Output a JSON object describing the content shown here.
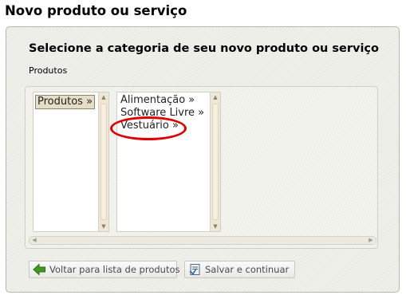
{
  "page": {
    "heading": "Novo produto ou serviço"
  },
  "form": {
    "title": "Selecione a categoria de seu novo produto ou serviço",
    "breadcrumb": "Produtos"
  },
  "category_lists": [
    {
      "options": [
        {
          "label": "Produtos »",
          "selected": true
        }
      ]
    },
    {
      "options": [
        {
          "label": "Alimentação »",
          "selected": false
        },
        {
          "label": "Software Livre »",
          "selected": false
        },
        {
          "label": "Vestuário »",
          "selected": false
        }
      ]
    }
  ],
  "annotation": {
    "highlight_color": "#e00000",
    "highlighted_option": "Vestuário »"
  },
  "buttons": {
    "back": {
      "label": "Voltar para lista de produtos",
      "icon": "green-left-arrow-icon"
    },
    "save": {
      "label": "Salvar e continuar",
      "icon": "save-document-icon"
    }
  },
  "colors": {
    "panel_bg": "#f1f1ec",
    "selected_option_bg": "#e6ddc6",
    "scrollbar_bg": "#efe6d3",
    "back_icon": "#3f9a1e"
  }
}
